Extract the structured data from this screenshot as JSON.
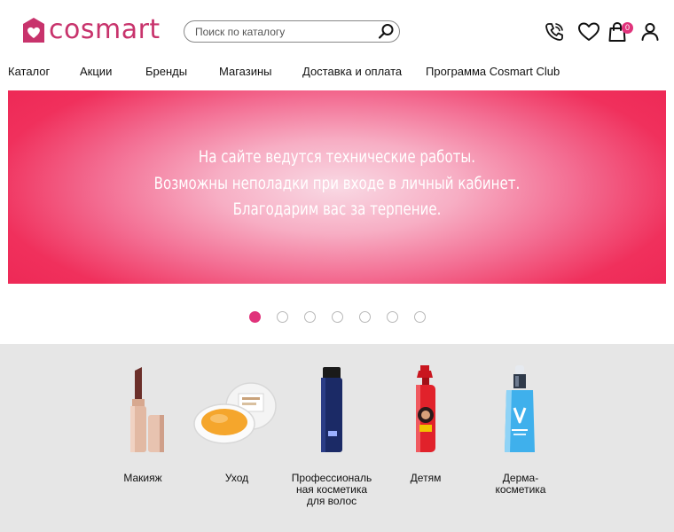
{
  "header": {
    "logo_text": "cosmart",
    "search": {
      "placeholder": "Поиск по каталогу"
    },
    "cart_count": "0",
    "icons": [
      "phone-icon",
      "heart-icon",
      "bag-icon",
      "user-icon",
      "search-icon"
    ]
  },
  "nav": {
    "items": [
      {
        "label": "Каталог"
      },
      {
        "label": "Акции"
      },
      {
        "label": "Бренды"
      },
      {
        "label": "Магазины"
      },
      {
        "label": "Доставка и оплата"
      },
      {
        "label": "Программа Cosmart Club"
      }
    ]
  },
  "banner": {
    "lines": [
      "На сайте ведутся технические работы.",
      "Возможны неполадки при входе в личный кабинет.",
      "Благодарим вас за терпение."
    ]
  },
  "slider": {
    "total": 7,
    "active": 1
  },
  "categories": [
    {
      "label": "Макияж"
    },
    {
      "label": "Уход"
    },
    {
      "label": "Профессиональ\nная косметика\nдля волос"
    },
    {
      "label": "Детям"
    },
    {
      "label": "Дерма-\nкосметика"
    }
  ],
  "colors": {
    "brand": "#c8336c",
    "accent": "#e0337b",
    "banner": "#ee2a57",
    "section_bg": "#e6e6e6"
  }
}
